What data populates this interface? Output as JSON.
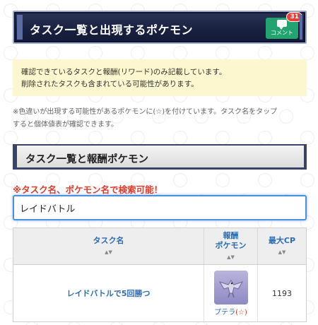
{
  "header": {
    "title": "タスク一覧と出現するポケモン",
    "comment_label": "コメント",
    "comment_count": "31"
  },
  "notice": {
    "line1": "確認できているタスクと報酬(リワード)のみ記載しています。",
    "line2": "削除されたタスクも含まれている可能性があります。"
  },
  "note": {
    "line1": "※色違いが出現する可能性があるポケモンに(☆)を付けています。タスク名をタップ",
    "line2": "すると個体値表が確認できます。"
  },
  "section": {
    "title": "タスク一覧と報酬ポケモン"
  },
  "search": {
    "hint": "※タスク名、ポケモン名で検索可能！",
    "value": "レイドバトル"
  },
  "table": {
    "headers": {
      "task": "タスク名",
      "reward_line1": "報酬",
      "reward_line2": "ポケモン",
      "cp": "最大CP",
      "sort_icon": "sort-arrows-icon"
    },
    "rows": [
      {
        "task": "レイドバトルで5回勝つ",
        "pokemon": "プテラ",
        "shiny": "(☆)",
        "cp": "1193",
        "image_icon": "aerodactyl-icon"
      }
    ]
  },
  "colors": {
    "banner": "#1a2141",
    "comment_button": "#23a36f",
    "badge": "#e8413c",
    "link": "#2a6cb4",
    "warning": "#e03a2a",
    "notice_bg": "#fdf7cf"
  }
}
